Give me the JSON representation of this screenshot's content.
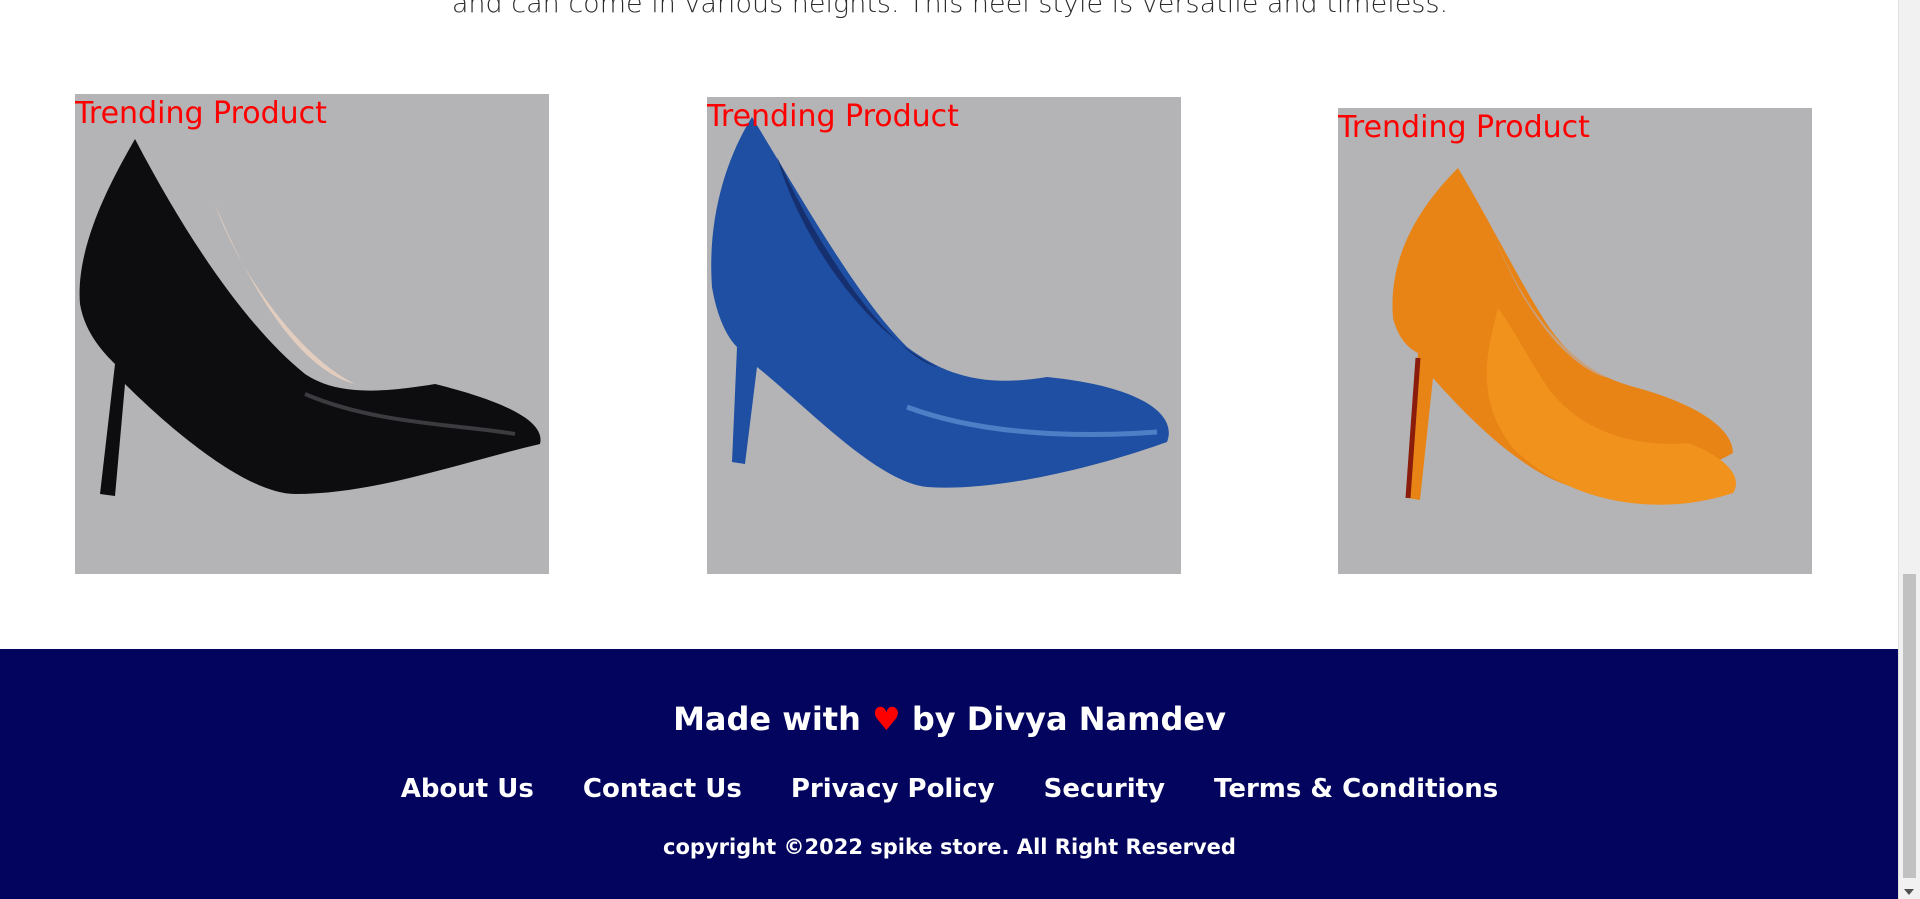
{
  "description": "and can come in various heights. This heel style is versatile and timeless.",
  "products": [
    {
      "label": "Trending Product",
      "shoe_color": "#0d0d10",
      "icon": "black-heel-shoe"
    },
    {
      "label": "Trending Product",
      "shoe_color": "#1e4fa3",
      "icon": "blue-heel-shoe"
    },
    {
      "label": "Trending Product",
      "shoe_color": "#e88415",
      "icon": "orange-heel-pair"
    }
  ],
  "footer": {
    "made_with": "Made with",
    "heart": "♥",
    "by_author": "by Divya Namdev",
    "links": [
      "About Us",
      "Contact Us",
      "Privacy Policy",
      "Security",
      "Terms & Conditions"
    ],
    "copyright": "copyright ©2022 spike store. All Right Reserved",
    "background": "#03045e"
  }
}
